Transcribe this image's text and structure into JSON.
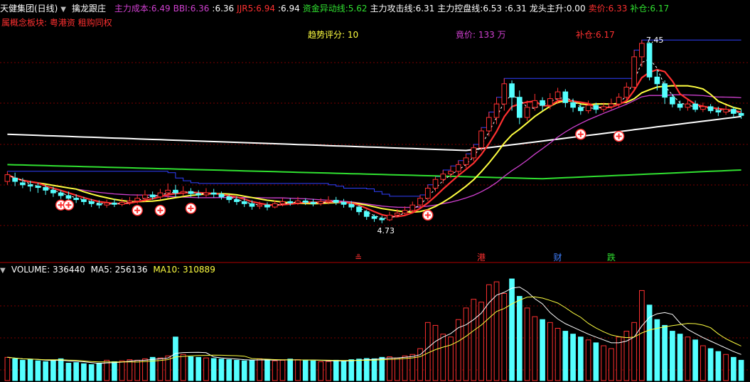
{
  "header": {
    "stock_name": "天健集团(日线)",
    "indicator_name": "擒龙跟庄",
    "items": [
      {
        "label": "主力成本:",
        "value": "6.49",
        "label_color": "#d040d0",
        "value_color": "#d040d0"
      },
      {
        "label": "BBI:",
        "value": "6.36",
        "label_color": "#d040d0",
        "value_color": "#d040d0"
      },
      {
        "label": ":",
        "value": "6.36",
        "label_color": "#ffffff",
        "value_color": "#ffffff"
      },
      {
        "label": "JJR5:",
        "value": "6.94",
        "label_color": "#ff3030",
        "value_color": "#ff3030"
      },
      {
        "label": ":",
        "value": "6.94",
        "label_color": "#ffffff",
        "value_color": "#ffffff"
      },
      {
        "label": "资金异动线:",
        "value": "5.62",
        "label_color": "#30e030",
        "value_color": "#30e030"
      },
      {
        "label": "主力攻击线:",
        "value": "6.31",
        "label_color": "#ffffff",
        "value_color": "#ffffff"
      },
      {
        "label": "主力控盘线:",
        "value": "6.53",
        "label_color": "#ffffff",
        "value_color": "#ffffff"
      },
      {
        "label": ":",
        "value": "6.31",
        "label_color": "#ffffff",
        "value_color": "#ffffff"
      },
      {
        "label": "龙头主升:",
        "value": "0.00",
        "label_color": "#ffffff",
        "value_color": "#ffffff"
      },
      {
        "label": "卖价:",
        "value": "6.33",
        "label_color": "#ff3030",
        "value_color": "#ff3030"
      },
      {
        "label": "补仓:",
        "value": "6.17",
        "label_color": "#30e030",
        "value_color": "#30e030"
      }
    ]
  },
  "sector": {
    "text": "属概念板块: 粤港资 租购同权"
  },
  "annotations": {
    "trend_score": "趋势评分: 10",
    "bid": "竟价: 133 万",
    "replenish": "补仓:6.17",
    "high_price": "7.45",
    "low_price": "4.73"
  },
  "markers": [
    {
      "text": "≗",
      "color": "#ff3030"
    },
    {
      "text": "港",
      "color": "#ff3030"
    },
    {
      "text": "财",
      "color": "#4080ff"
    },
    {
      "text": "跌",
      "color": "#30e030"
    }
  ],
  "volume": {
    "label": "VOLUME:",
    "value": "336440",
    "ma5_label": "MA5:",
    "ma5": "256136",
    "ma10_label": "MA10:",
    "ma10": "310889"
  },
  "colors": {
    "up": "#ff3030",
    "down": "#54ffff",
    "ma_white": "#ffffff",
    "ma_green": "#30e030",
    "ma_yellow": "#ffff40",
    "ma_magenta": "#d040d0",
    "box_blue": "#3040ff",
    "grid": "#7a0000"
  },
  "chart_data": {
    "type": "candlestick",
    "title": "",
    "price_range": [
      4.4,
      7.6
    ],
    "candles": [
      [
        5.35,
        5.45,
        5.5,
        5.3
      ],
      [
        5.4,
        5.35,
        5.48,
        5.28
      ],
      [
        5.33,
        5.3,
        5.4,
        5.25
      ],
      [
        5.3,
        5.28,
        5.36,
        5.2
      ],
      [
        5.28,
        5.26,
        5.33,
        5.18
      ],
      [
        5.26,
        5.22,
        5.3,
        5.15
      ],
      [
        5.22,
        5.18,
        5.27,
        5.12
      ],
      [
        5.18,
        5.14,
        5.22,
        5.09
      ],
      [
        5.14,
        5.1,
        5.2,
        5.05
      ],
      [
        5.1,
        5.08,
        5.16,
        5.03
      ],
      [
        5.08,
        5.05,
        5.12,
        5.0
      ],
      [
        5.05,
        5.02,
        5.09,
        4.97
      ],
      [
        5.02,
        5.0,
        5.07,
        4.95
      ],
      [
        5.0,
        5.03,
        5.08,
        4.96
      ],
      [
        5.03,
        5.01,
        5.09,
        4.97
      ],
      [
        5.01,
        5.04,
        5.1,
        4.98
      ],
      [
        5.04,
        5.06,
        5.12,
        5.0
      ],
      [
        5.06,
        5.1,
        5.16,
        5.02
      ],
      [
        5.1,
        5.15,
        5.22,
        5.05
      ],
      [
        5.15,
        5.12,
        5.2,
        5.08
      ],
      [
        5.12,
        5.18,
        5.24,
        5.08
      ],
      [
        5.18,
        5.22,
        5.32,
        5.1
      ],
      [
        5.22,
        5.18,
        5.3,
        5.12
      ],
      [
        5.18,
        5.2,
        5.28,
        5.14
      ],
      [
        5.2,
        5.17,
        5.25,
        5.12
      ],
      [
        5.17,
        5.15,
        5.22,
        5.1
      ],
      [
        5.15,
        5.18,
        5.25,
        5.12
      ],
      [
        5.18,
        5.16,
        5.24,
        5.11
      ],
      [
        5.16,
        5.12,
        5.2,
        5.08
      ],
      [
        5.12,
        5.08,
        5.16,
        5.03
      ],
      [
        5.08,
        5.05,
        5.13,
        5.0
      ],
      [
        5.05,
        5.02,
        5.1,
        4.97
      ],
      [
        5.02,
        4.98,
        5.07,
        4.93
      ],
      [
        4.98,
        5.0,
        5.05,
        4.94
      ],
      [
        5.0,
        4.97,
        5.04,
        4.92
      ],
      [
        4.97,
        5.02,
        5.07,
        4.95
      ],
      [
        5.02,
        5.05,
        5.1,
        4.98
      ],
      [
        5.05,
        5.03,
        5.1,
        4.99
      ],
      [
        5.03,
        5.06,
        5.12,
        5.0
      ],
      [
        5.06,
        5.04,
        5.1,
        5.0
      ],
      [
        5.04,
        5.02,
        5.09,
        4.98
      ],
      [
        5.02,
        5.05,
        5.1,
        4.99
      ],
      [
        5.05,
        5.07,
        5.13,
        5.01
      ],
      [
        5.07,
        5.04,
        5.12,
        5.0
      ],
      [
        5.04,
        5.01,
        5.09,
        4.96
      ],
      [
        5.01,
        4.97,
        5.06,
        4.92
      ],
      [
        4.97,
        4.9,
        5.0,
        4.85
      ],
      [
        4.9,
        4.83,
        4.93,
        4.78
      ],
      [
        4.83,
        4.8,
        4.86,
        4.75
      ],
      [
        4.8,
        4.78,
        4.84,
        4.73
      ],
      [
        4.78,
        4.85,
        4.9,
        4.76
      ],
      [
        4.85,
        4.88,
        4.94,
        4.82
      ],
      [
        4.88,
        4.92,
        4.98,
        4.86
      ],
      [
        4.92,
        5.0,
        5.05,
        4.9
      ],
      [
        5.0,
        5.1,
        5.15,
        4.98
      ],
      [
        5.1,
        5.25,
        5.3,
        5.06
      ],
      [
        5.25,
        5.38,
        5.42,
        5.2
      ],
      [
        5.38,
        5.46,
        5.52,
        5.32
      ],
      [
        5.46,
        5.5,
        5.58,
        5.4
      ],
      [
        5.5,
        5.6,
        5.66,
        5.45
      ],
      [
        5.6,
        5.7,
        5.76,
        5.55
      ],
      [
        5.7,
        5.85,
        5.9,
        5.65
      ],
      [
        5.85,
        6.1,
        6.15,
        5.8
      ],
      [
        6.1,
        6.3,
        6.38,
        6.02
      ],
      [
        6.3,
        6.5,
        6.6,
        6.2
      ],
      [
        6.5,
        6.8,
        6.88,
        6.4
      ],
      [
        6.8,
        6.6,
        6.85,
        6.4
      ],
      [
        6.6,
        6.3,
        6.7,
        6.2
      ],
      [
        6.3,
        6.45,
        6.55,
        6.25
      ],
      [
        6.45,
        6.55,
        6.65,
        6.4
      ],
      [
        6.55,
        6.48,
        6.6,
        6.4
      ],
      [
        6.48,
        6.58,
        6.66,
        6.42
      ],
      [
        6.58,
        6.68,
        6.74,
        6.5
      ],
      [
        6.68,
        6.52,
        6.72,
        6.45
      ],
      [
        6.52,
        6.45,
        6.58,
        6.38
      ],
      [
        6.45,
        6.4,
        6.5,
        6.34
      ],
      [
        6.4,
        6.48,
        6.55,
        6.36
      ],
      [
        6.48,
        6.42,
        6.52,
        6.36
      ],
      [
        6.42,
        6.46,
        6.52,
        6.38
      ],
      [
        6.46,
        6.5,
        6.58,
        6.42
      ],
      [
        6.5,
        6.6,
        6.66,
        6.45
      ],
      [
        6.6,
        6.75,
        6.82,
        6.55
      ],
      [
        6.75,
        7.2,
        7.3,
        6.7
      ],
      [
        7.2,
        7.4,
        7.45,
        7.05
      ],
      [
        7.4,
        6.9,
        7.42,
        6.85
      ],
      [
        6.9,
        6.8,
        7.0,
        6.7
      ],
      [
        6.8,
        6.6,
        6.85,
        6.5
      ],
      [
        6.6,
        6.5,
        6.65,
        6.45
      ],
      [
        6.5,
        6.45,
        6.55,
        6.4
      ],
      [
        6.45,
        6.5,
        6.58,
        6.4
      ],
      [
        6.5,
        6.42,
        6.55,
        6.38
      ],
      [
        6.42,
        6.46,
        6.52,
        6.38
      ],
      [
        6.46,
        6.4,
        6.5,
        6.36
      ],
      [
        6.4,
        6.38,
        6.46,
        6.32
      ],
      [
        6.38,
        6.42,
        6.48,
        6.34
      ],
      [
        6.42,
        6.36,
        6.46,
        6.3
      ],
      [
        6.36,
        6.33,
        6.42,
        6.28
      ]
    ],
    "volumes": [
      80,
      75,
      70,
      72,
      68,
      65,
      70,
      75,
      60,
      62,
      58,
      55,
      60,
      70,
      65,
      68,
      72,
      70,
      75,
      80,
      78,
      85,
      150,
      90,
      82,
      80,
      78,
      76,
      74,
      72,
      70,
      68,
      70,
      75,
      72,
      68,
      70,
      74,
      72,
      70,
      68,
      65,
      66,
      70,
      68,
      72,
      74,
      76,
      75,
      80,
      82,
      78,
      85,
      90,
      110,
      200,
      190,
      160,
      150,
      210,
      250,
      280,
      270,
      330,
      340,
      300,
      350,
      290,
      250,
      220,
      210,
      200,
      180,
      170,
      160,
      150,
      140,
      130,
      120,
      110,
      150,
      170,
      200,
      310,
      260,
      210,
      190,
      170,
      160,
      150,
      140,
      120,
      110,
      100,
      90,
      80,
      70
    ],
    "volume_range": [
      0,
      360000
    ]
  }
}
